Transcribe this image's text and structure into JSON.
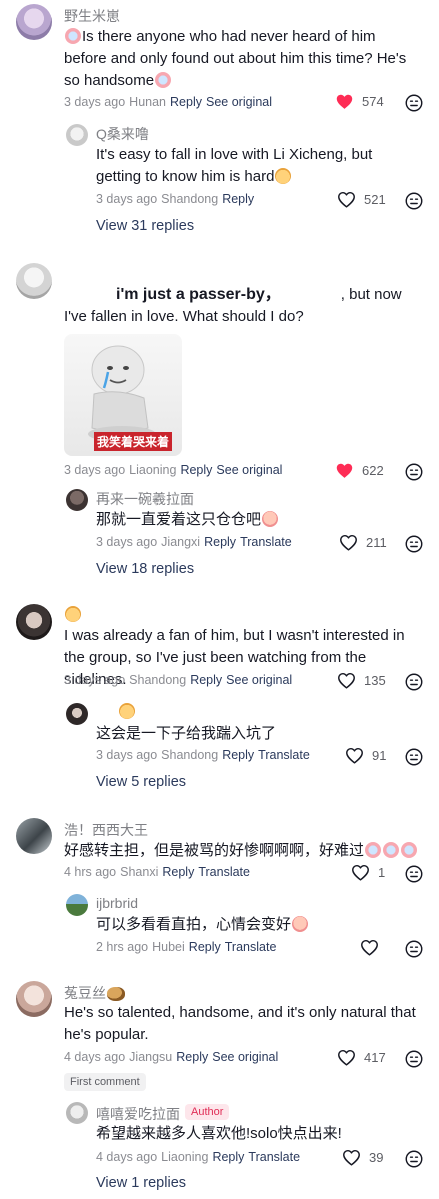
{
  "comments": [
    {
      "user": "野生米崽",
      "text_before": "",
      "text": "Is there anyone who had never heard of him before and only found out about him this time? He's so handsome",
      "meta": {
        "time": "3 days ago",
        "location": "Hunan",
        "reply": "Reply",
        "action": "See original"
      },
      "likes": "574",
      "liked": true,
      "reply": {
        "user": "Q桑来噜",
        "text": "It's easy to fall in love with Li Xicheng, but getting to know him is hard",
        "meta": {
          "time": "3 days ago",
          "location": "Shandong",
          "reply": "Reply"
        },
        "likes": "521"
      },
      "view_replies": "View 31 replies"
    },
    {
      "user": "",
      "text_bold": "i'm just a passer-by，",
      "text": ", but now I've fallen in love. What should I do?",
      "image_caption": "我笑着哭来着",
      "meta": {
        "time": "3 days ago",
        "location": "Liaoning",
        "reply": "Reply",
        "action": "See original"
      },
      "likes": "622",
      "liked": true,
      "reply": {
        "user": "再来一碗羲拉面",
        "text": "那就一直爱着这只仓仓吧",
        "meta": {
          "time": "3 days ago",
          "location": "Jiangxi",
          "reply": "Reply",
          "action": "Translate"
        },
        "likes": "211"
      },
      "view_replies": "View 18 replies"
    },
    {
      "user": "",
      "text": "I was already a fan of him, but I wasn't interested in the group, so I've just been watching from the sidelines.",
      "meta": {
        "time": "3 days ago",
        "location": "Shandong",
        "reply": "Reply",
        "action": "See original"
      },
      "likes": "135",
      "reply": {
        "user": "",
        "text": "这会是一下子给我踹入坑了",
        "meta": {
          "time": "3 days ago",
          "location": "Shandong",
          "reply": "Reply",
          "action": "Translate"
        },
        "likes": "91"
      },
      "view_replies": "View 5 replies"
    },
    {
      "user": "浩！西西大王",
      "text": "好感转主担，但是被骂的好惨啊啊啊，好难过",
      "meta": {
        "time": "4 hrs ago",
        "location": "Shanxi",
        "reply": "Reply",
        "action": "Translate"
      },
      "likes": "1",
      "reply": {
        "user": "ijbrbrid",
        "text": "可以多看看直拍，心情会变好",
        "meta": {
          "time": "2 hrs ago",
          "location": "Hubei",
          "reply": "Reply",
          "action": "Translate"
        },
        "likes": ""
      }
    },
    {
      "user": "菟豆丝",
      "text": "He's so talented, handsome, and it's only natural that he's popular.",
      "meta": {
        "time": "4 days ago",
        "location": "Jiangsu",
        "reply": "Reply",
        "action": "See original"
      },
      "likes": "417",
      "badge": "First comment",
      "reply": {
        "user": "嘻嘻爱吃拉面",
        "author_tag": "Author",
        "text": "希望越来越多人喜欢他!solo快点出来!",
        "meta": {
          "time": "4 days ago",
          "location": "Liaoning",
          "reply": "Reply",
          "action": "Translate"
        },
        "likes": "39"
      },
      "view_replies": "View 1 replies"
    }
  ],
  "colors": {
    "liked": "#fe2c55",
    "link": "#2b3a5c",
    "muted": "#8a8b91"
  },
  "icons": {
    "like": "heart-icon",
    "dislike": "dislike-face-icon"
  }
}
